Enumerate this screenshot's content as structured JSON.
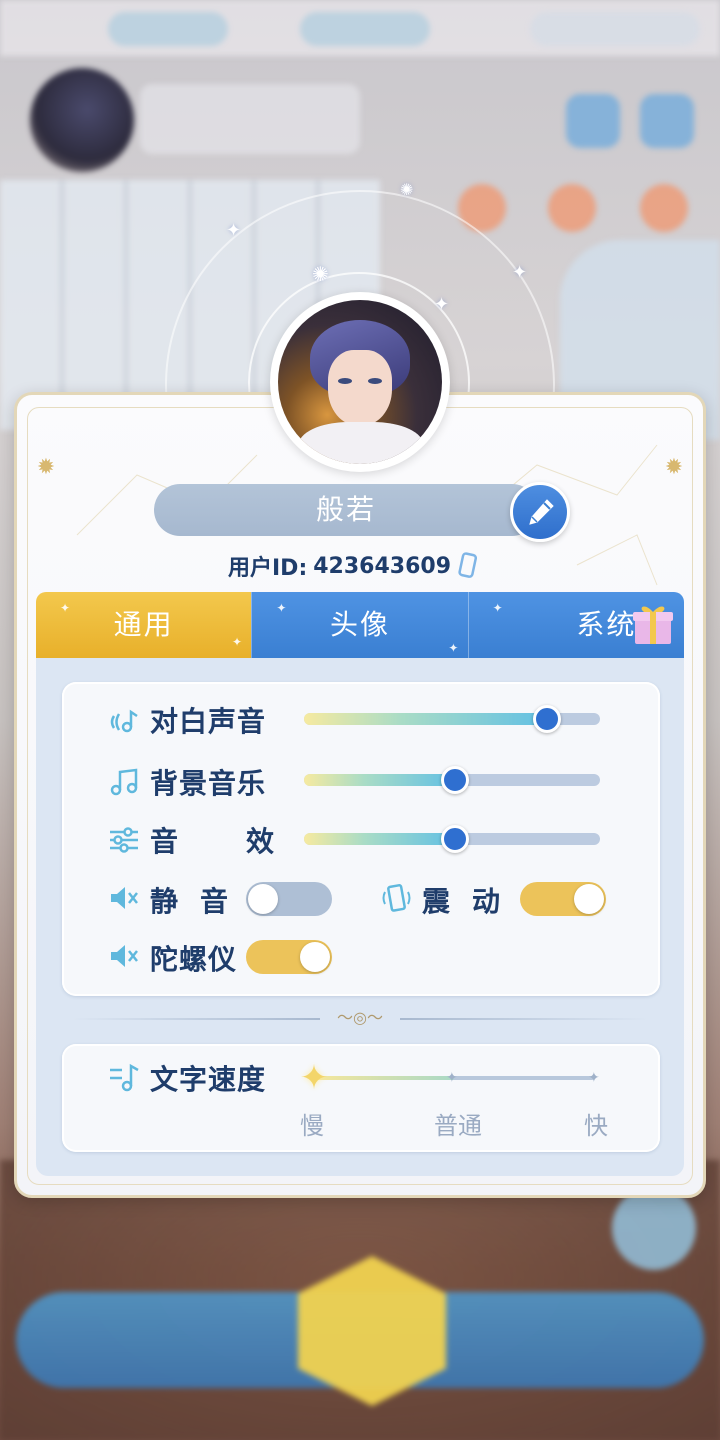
{
  "profile": {
    "name": "般若",
    "uid_label": "用户ID:",
    "uid_value": "423643609"
  },
  "tabs": [
    {
      "label": "通用",
      "active": true
    },
    {
      "label": "头像",
      "active": false
    },
    {
      "label": "系统",
      "active": false
    }
  ],
  "audio": {
    "dialogue": {
      "label": "对白声音",
      "value": 0.82
    },
    "bgm": {
      "label": "背景音乐",
      "value": 0.51
    },
    "sfx": {
      "label_a": "音",
      "label_b": "效",
      "value": 0.51
    }
  },
  "toggles": {
    "mute": {
      "label_a": "静",
      "label_b": "音",
      "on": false
    },
    "vibrate": {
      "label_a": "震",
      "label_b": "动",
      "on": true
    },
    "gyro": {
      "label": "陀螺仪",
      "on": true
    }
  },
  "text_speed": {
    "label": "文字速度",
    "levels": [
      "慢",
      "普通",
      "快"
    ],
    "selected": "慢"
  },
  "colors": {
    "accent_blue": "#3a7fd2",
    "active_tab": "#e8b02a",
    "toggle_on": "#ecc35a",
    "toggle_off": "#aebfd5",
    "text_dark": "#1f3d6b"
  }
}
